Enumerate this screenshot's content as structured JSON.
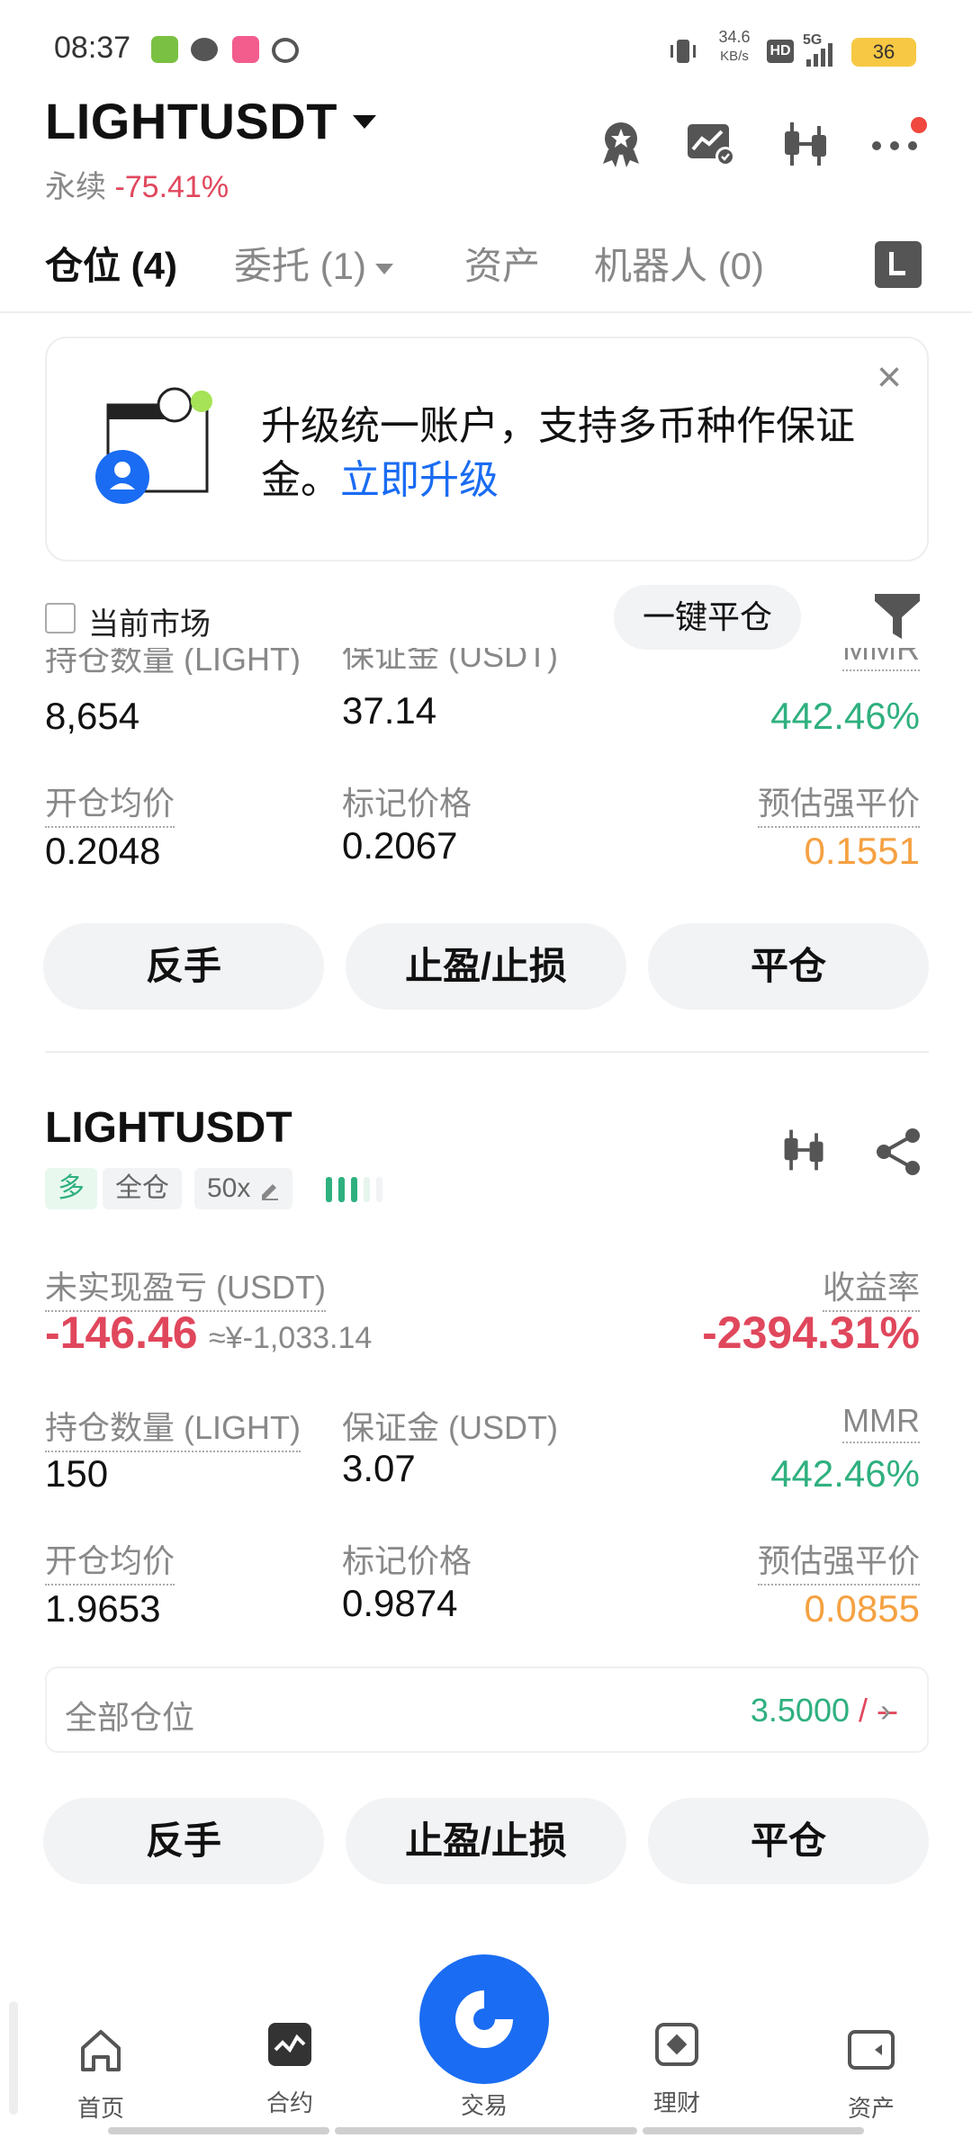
{
  "status_bar": {
    "time": "08:37",
    "net_speed": "34.6",
    "net_unit": "KB/s",
    "hd": "HD",
    "signal": "5G",
    "battery": "36"
  },
  "header": {
    "symbol": "LIGHTUSDT",
    "contract_type": "永续",
    "change": "-75.41%"
  },
  "tabs": [
    {
      "label": "仓位 (4)",
      "active": true
    },
    {
      "label": "委托 (1)",
      "active": false
    },
    {
      "label": "资产",
      "active": false
    },
    {
      "label": "机器人 (0)",
      "active": false
    }
  ],
  "banner": {
    "text": "升级统一账户，支持多币种作保证金。",
    "link": "立即升级"
  },
  "filter": {
    "current_market_label": "当前市场",
    "close_all_label": "一键平仓"
  },
  "position1": {
    "qty_label": "持仓数量 (LIGHT)",
    "qty": "8,654",
    "margin_label": "保证金 (USDT)",
    "margin": "37.14",
    "mmr_label": "MMR",
    "mmr": "442.46%",
    "entry_label": "开仓均价",
    "entry": "0.2048",
    "mark_label": "标记价格",
    "mark": "0.2067",
    "liq_label": "预估强平价",
    "liq": "0.1551"
  },
  "position2": {
    "symbol": "LIGHTUSDT",
    "side": "多",
    "margin_mode": "全仓",
    "leverage": "50x",
    "pnl_label": "未实现盈亏 (USDT)",
    "pnl": "-146.46",
    "pnl_cny": "≈¥-1,033.14",
    "roe_label": "收益率",
    "roe": "-2394.31%",
    "qty_label": "持仓数量 (LIGHT)",
    "qty": "150",
    "margin_label": "保证金 (USDT)",
    "margin": "3.07",
    "mmr_label": "MMR",
    "mmr": "442.46%",
    "entry_label": "开仓均价",
    "entry": "1.9653",
    "mark_label": "标记价格",
    "mark": "0.9874",
    "liq_label": "预估强平价",
    "liq": "0.0855",
    "all_positions_label": "全部仓位",
    "all_positions_value": "3.5000",
    "all_positions_sep": "/ --"
  },
  "actions": {
    "reverse": "反手",
    "tpsl": "止盈/止损",
    "close": "平仓"
  },
  "bottom_nav": [
    {
      "label": "首页",
      "icon": "home-icon"
    },
    {
      "label": "合约",
      "icon": "futures-icon"
    },
    {
      "label": "交易",
      "icon": "trade-icon"
    },
    {
      "label": "理财",
      "icon": "earn-icon"
    },
    {
      "label": "资产",
      "icon": "wallet-icon"
    }
  ],
  "colors": {
    "accent": "#1a6cf2",
    "down": "#e0475c",
    "up": "#2fb07f",
    "warning": "#f5a142"
  }
}
